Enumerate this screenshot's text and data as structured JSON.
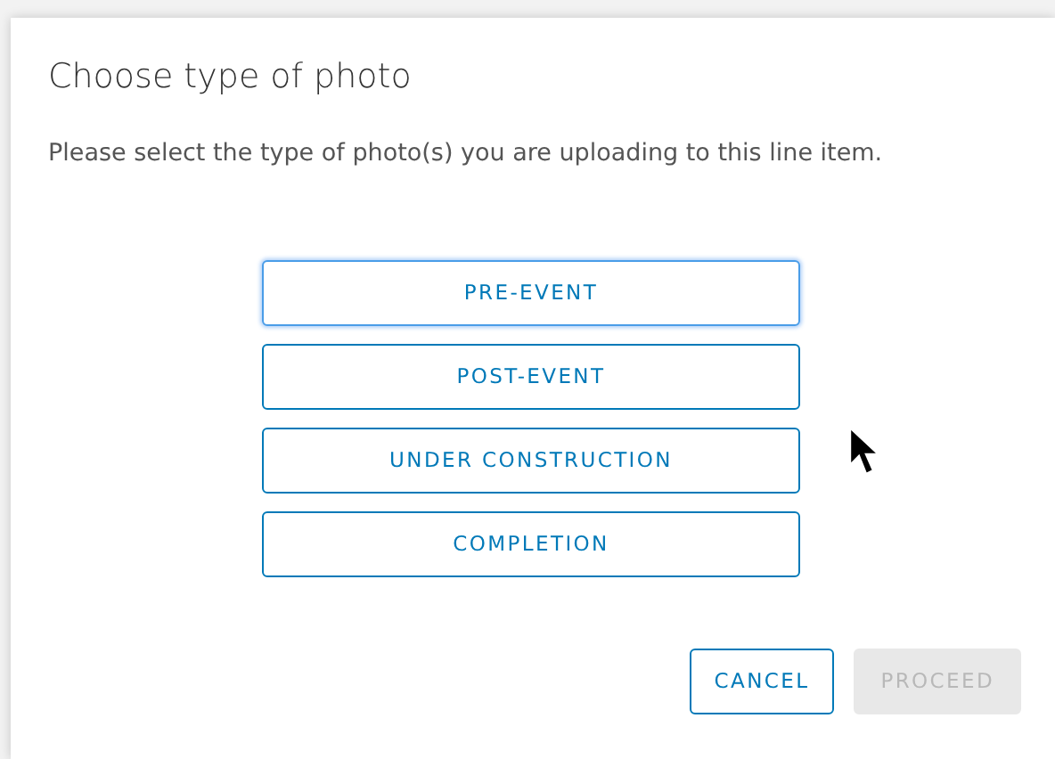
{
  "dialog": {
    "title": "Choose type of photo",
    "message": "Please select the type of photo(s) you are uploading to this line item.",
    "options": [
      {
        "label": "PRE-EVENT",
        "focused": true
      },
      {
        "label": "POST-EVENT",
        "focused": false
      },
      {
        "label": "UNDER CONSTRUCTION",
        "focused": false
      },
      {
        "label": "COMPLETION",
        "focused": false
      }
    ],
    "actions": [
      {
        "label": "CANCEL",
        "disabled": false
      },
      {
        "label": "PROCEED",
        "disabled": true
      }
    ]
  }
}
